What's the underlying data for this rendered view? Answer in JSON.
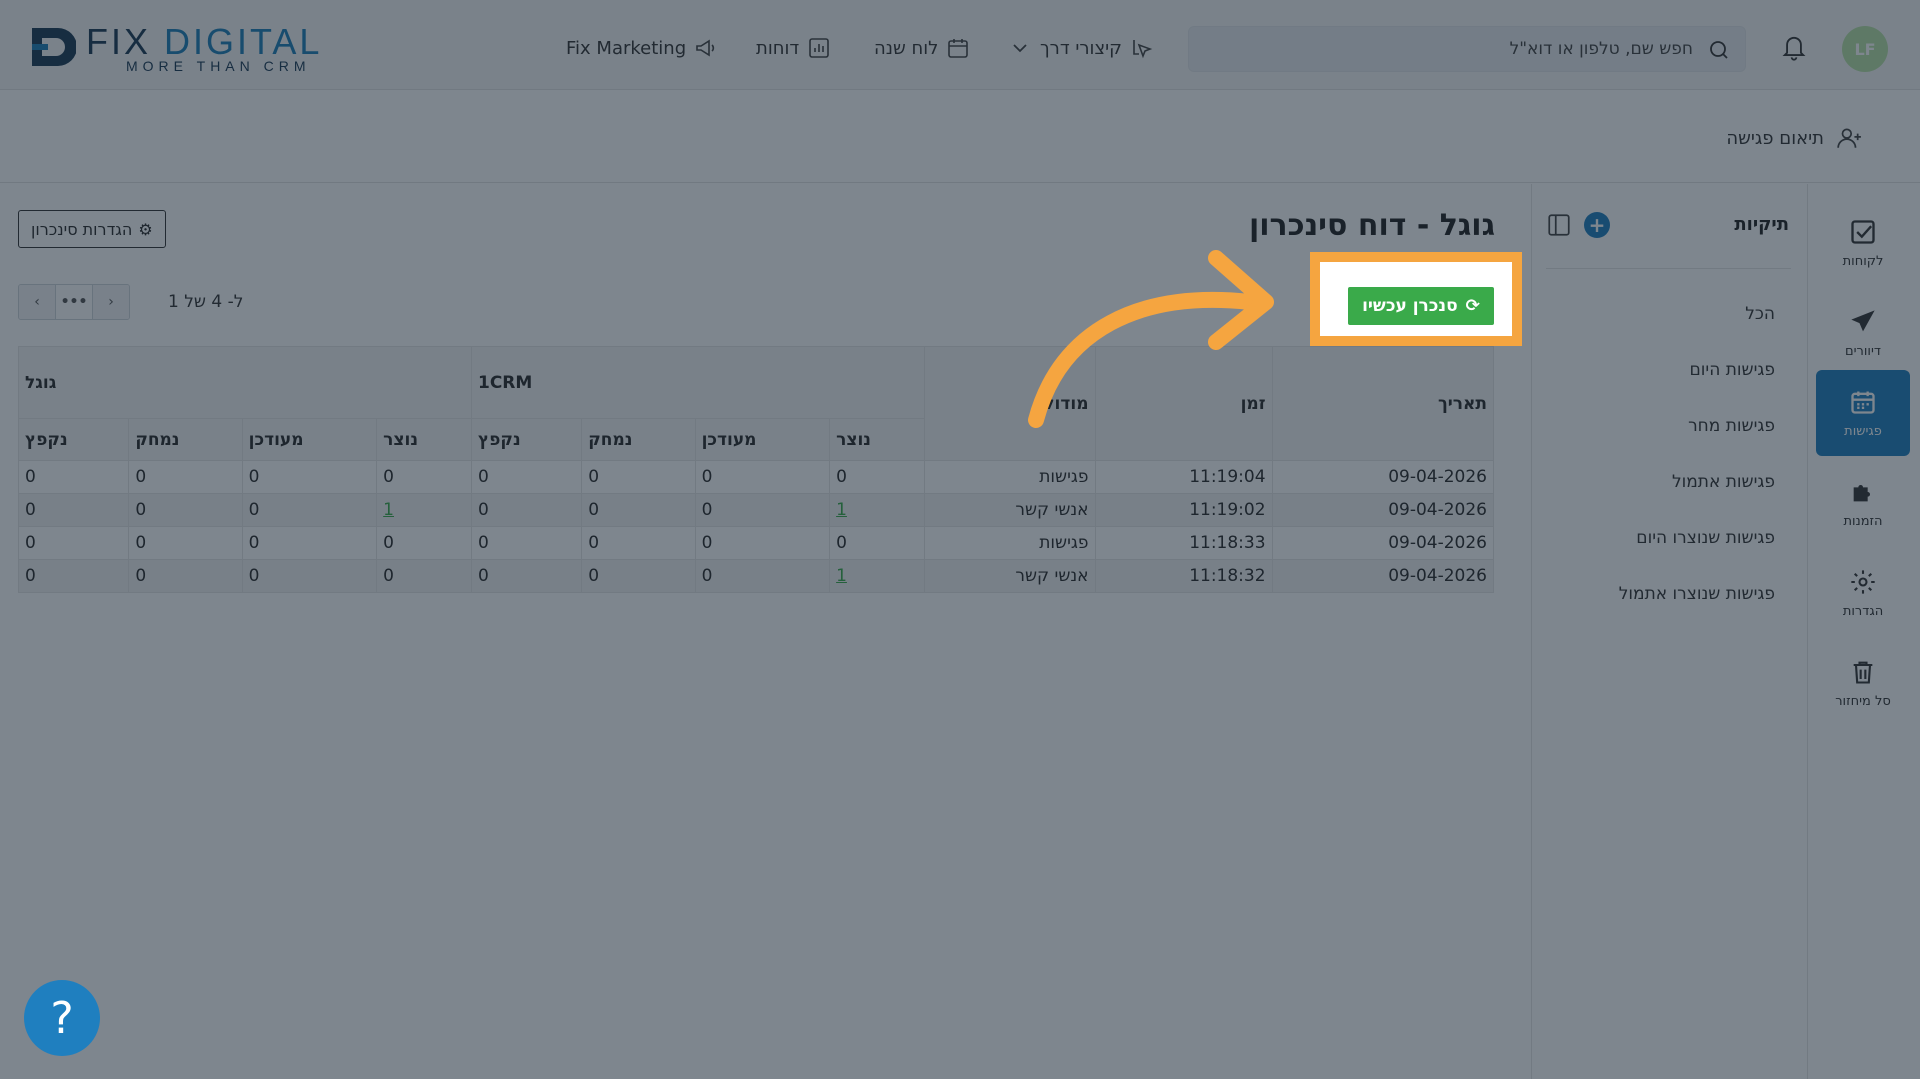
{
  "brand": {
    "logo_text_left": "FIX",
    "logo_text_right": "DIGITAL",
    "logo_sub": "MORE THAN CRM"
  },
  "nav": {
    "marketing": "Fix Marketing",
    "reports": "דוחות",
    "calendar": "לוח שנה",
    "shortcuts": "קיצורי דרך"
  },
  "search": {
    "placeholder": "חפש שם, טלפון או דוא\"ל"
  },
  "user": {
    "initials": "LF"
  },
  "subbar": {
    "match_meeting": "תיאום פגישה"
  },
  "rail": [
    {
      "label": "לקוחות",
      "icon": "check-square-icon"
    },
    {
      "label": "דיוורים",
      "icon": "paper-plane-icon"
    },
    {
      "label": "פגישות",
      "icon": "calendar-icon"
    },
    {
      "label": "הזמנות",
      "icon": "puzzle-icon"
    },
    {
      "label": "הגדרות",
      "icon": "gear-icon"
    },
    {
      "label": "סל מיחזור",
      "icon": "trash-icon"
    }
  ],
  "folders": {
    "title": "תיקיות",
    "items": [
      "הכל",
      "פגישות היום",
      "פגישות מחר",
      "פגישות אתמול",
      "פגישות שנוצרו היום",
      "פגישות שנוצרו אתמול"
    ]
  },
  "page": {
    "title": "גוגל - דוח סינכרון",
    "sync_settings": "הגדרות סינכרון",
    "sync_now": "סנכרן עכשיו",
    "count_label": "1 ל- 4 של",
    "pager_mid": "•••",
    "pager_prev": "‹",
    "pager_next": "›"
  },
  "table": {
    "headers": {
      "date": "תאריך",
      "time": "זמן",
      "module": "מודול",
      "group_crm": "1CRM",
      "group_google": "גוגל",
      "created": "נוצר",
      "updated": "מעודכן",
      "deleted": "נמחק",
      "skipped": "נקפץ"
    },
    "rows": [
      {
        "date": "09-04-2026",
        "time": "11:19:04",
        "module": "פגישות",
        "crm": [
          "0",
          "0",
          "0",
          "0"
        ],
        "google": [
          "0",
          "0",
          "0",
          "0"
        ]
      },
      {
        "date": "09-04-2026",
        "time": "11:19:02",
        "module": "אנשי קשר",
        "crm": [
          "1",
          "0",
          "0",
          "0"
        ],
        "google": [
          "1",
          "0",
          "0",
          "0"
        ]
      },
      {
        "date": "09-04-2026",
        "time": "11:18:33",
        "module": "פגישות",
        "crm": [
          "0",
          "0",
          "0",
          "0"
        ],
        "google": [
          "0",
          "0",
          "0",
          "0"
        ]
      },
      {
        "date": "09-04-2026",
        "time": "11:18:32",
        "module": "אנשי קשר",
        "crm": [
          "1",
          "0",
          "0",
          "0"
        ],
        "google": [
          "0",
          "0",
          "0",
          "0"
        ]
      }
    ]
  },
  "help": {
    "label": "?"
  },
  "colors": {
    "primary": "#1f7fbf",
    "success": "#3aaa4a",
    "highlight": "#f5a540",
    "overlay": "rgba(20,35,50,0.55)"
  }
}
